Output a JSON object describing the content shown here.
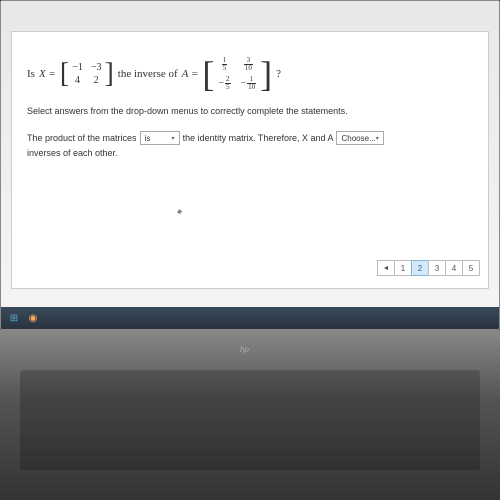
{
  "question": {
    "prefix": "Is",
    "varX": "X =",
    "matrixX": {
      "r1c1": "−1",
      "r1c2": "−3",
      "r2c1": "4",
      "r2c2": "2"
    },
    "middle": "the inverse of",
    "varA": "A =",
    "matrixA": {
      "r1c1_num": "1",
      "r1c1_den": "5",
      "r1c2_num": "3",
      "r1c2_den": "10",
      "r2c1_sign": "−",
      "r2c1_num": "2",
      "r2c1_den": "5",
      "r2c2_sign": "−",
      "r2c2_num": "1",
      "r2c2_den": "10"
    },
    "suffix": "?"
  },
  "instructions": "Select answers from the drop-down menus to correctly complete the statements.",
  "answer": {
    "part1": "The product of the matrices",
    "dropdown1": "is",
    "part2": "the identity matrix. Therefore, X and A",
    "dropdown2": "Choose...",
    "part3": "inverses of each other."
  },
  "pagination": {
    "prev": "◄",
    "pages": [
      "1",
      "2",
      "3",
      "4",
      "5"
    ],
    "active": "2"
  },
  "logo": "hp"
}
